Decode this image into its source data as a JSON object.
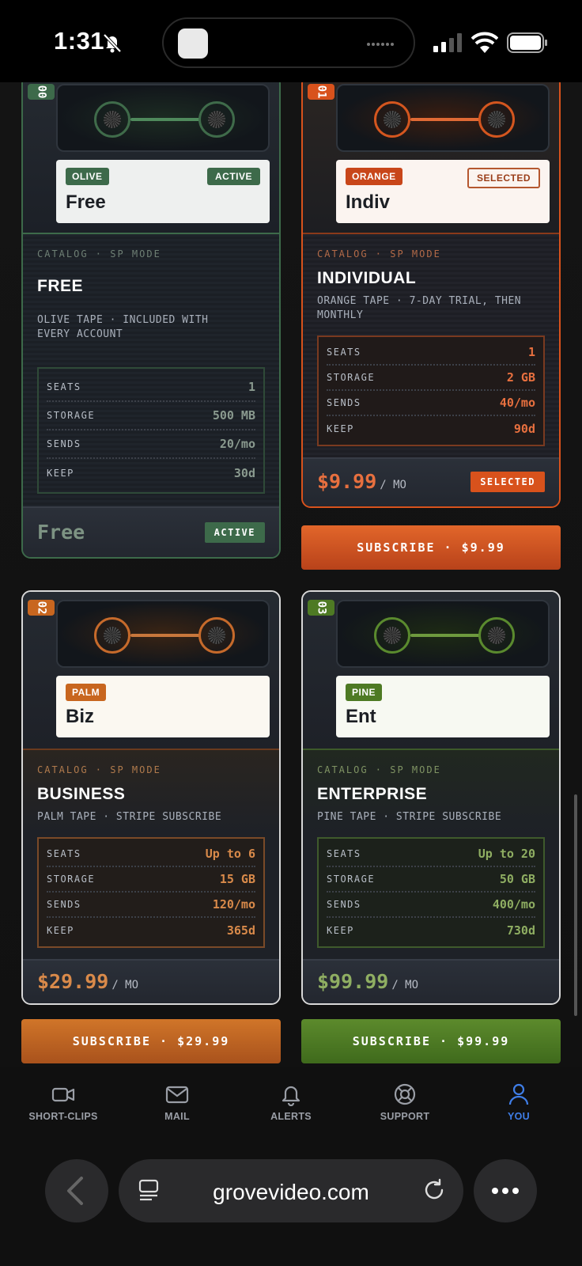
{
  "status": {
    "time": "1:31"
  },
  "plans": [
    {
      "num": "00",
      "tape": "OLIVE",
      "short": "Free",
      "state": "ACTIVE",
      "catalog": "CATALOG · SP MODE",
      "name": "FREE",
      "sub": "OLIVE TAPE · INCLUDED WITH EVERY ACCOUNT",
      "specs": [
        {
          "k": "SEATS",
          "v": "1"
        },
        {
          "k": "STORAGE",
          "v": "500 MB"
        },
        {
          "k": "SENDS",
          "v": "20/mo"
        },
        {
          "k": "KEEP",
          "v": "30d"
        }
      ],
      "price": "Free",
      "per": "",
      "foot_badge": "ACTIVE",
      "button": ""
    },
    {
      "num": "01",
      "tape": "ORANGE",
      "short": "Indiv",
      "state": "SELECTED",
      "catalog": "CATALOG · SP MODE",
      "name": "INDIVIDUAL",
      "sub": "ORANGE TAPE · 7-DAY TRIAL, THEN MONTHLY",
      "specs": [
        {
          "k": "SEATS",
          "v": "1"
        },
        {
          "k": "STORAGE",
          "v": "2 GB"
        },
        {
          "k": "SENDS",
          "v": "40/mo"
        },
        {
          "k": "KEEP",
          "v": "90d"
        }
      ],
      "price": "$9.99",
      "per": "/ MO",
      "foot_badge": "SELECTED",
      "button": "SUBSCRIBE · $9.99"
    },
    {
      "num": "02",
      "tape": "PALM",
      "short": "Biz",
      "state": "",
      "catalog": "CATALOG · SP MODE",
      "name": "BUSINESS",
      "sub": "PALM TAPE · STRIPE SUBSCRIBE",
      "specs": [
        {
          "k": "SEATS",
          "v": "Up to 6"
        },
        {
          "k": "STORAGE",
          "v": "15 GB"
        },
        {
          "k": "SENDS",
          "v": "120/mo"
        },
        {
          "k": "KEEP",
          "v": "365d"
        }
      ],
      "price": "$29.99",
      "per": "/ MO",
      "foot_badge": "",
      "button": "SUBSCRIBE · $29.99"
    },
    {
      "num": "03",
      "tape": "PINE",
      "short": "Ent",
      "state": "",
      "catalog": "CATALOG · SP MODE",
      "name": "ENTERPRISE",
      "sub": "PINE TAPE · STRIPE SUBSCRIBE",
      "specs": [
        {
          "k": "SEATS",
          "v": "Up to 20"
        },
        {
          "k": "STORAGE",
          "v": "50 GB"
        },
        {
          "k": "SENDS",
          "v": "400/mo"
        },
        {
          "k": "KEEP",
          "v": "730d"
        }
      ],
      "price": "$99.99",
      "per": "/ MO",
      "foot_badge": "",
      "button": "SUBSCRIBE · $99.99"
    }
  ],
  "colors": {
    "olive": "#3d6a4a",
    "orange": "#d8521c",
    "palm": "#c8661f",
    "pine": "#4e7a24",
    "active_tab": "#3f7ee8"
  },
  "tabs": [
    {
      "label": "SHORT-CLIPS",
      "icon": "video-camera-icon"
    },
    {
      "label": "MAIL",
      "icon": "mail-icon"
    },
    {
      "label": "ALERTS",
      "icon": "bell-icon"
    },
    {
      "label": "SUPPORT",
      "icon": "lifebuoy-icon"
    },
    {
      "label": "YOU",
      "icon": "person-icon"
    }
  ],
  "browser": {
    "url": "grovevideo.com"
  }
}
